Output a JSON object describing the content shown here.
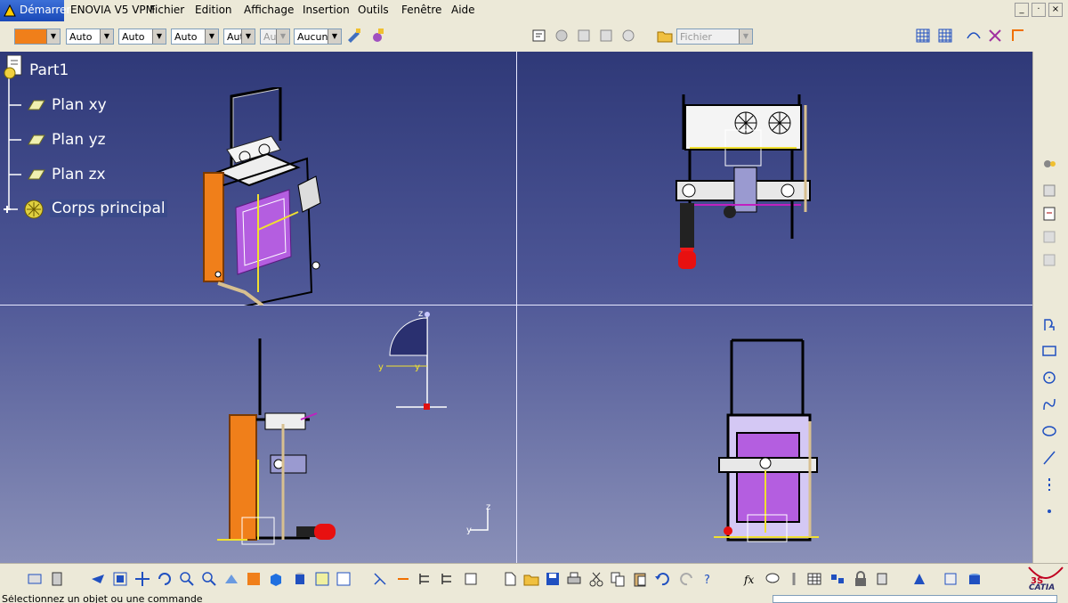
{
  "menubar": {
    "start": "Démarrer",
    "items": [
      "ENOVIA V5 VPM",
      "Fichier",
      "Edition",
      "Affichage",
      "Insertion",
      "Outils",
      "Fenêtre",
      "Aide"
    ],
    "window_controls": [
      "_",
      "·",
      "×"
    ]
  },
  "toolbar_top": {
    "combos": [
      {
        "value": "Auto"
      },
      {
        "value": "Auto"
      },
      {
        "value": "Auto"
      },
      {
        "value": "Aut"
      },
      {
        "value": "Aut",
        "disabled": true
      },
      {
        "value": "Aucun"
      }
    ],
    "file_combo": "Fichier"
  },
  "tree": {
    "root": "Part1",
    "items": [
      {
        "label": "Plan xy"
      },
      {
        "label": "Plan yz"
      },
      {
        "label": "Plan zx"
      },
      {
        "label": "Corps principal"
      }
    ]
  },
  "viewport": {
    "axis_labels": {
      "z": "z",
      "y": "y",
      "y2": "y",
      "z2": "z",
      "y3": "y"
    }
  },
  "status": {
    "text": "Sélectionnez un objet ou une commande"
  },
  "brand": {
    "logo_text": "CATIA"
  },
  "colors": {
    "accent_orange": "#f07f1a",
    "viewport_top": "#2f3978",
    "viewport_bottom": "#8a90b8",
    "selection_yellow": "#f0e030"
  }
}
